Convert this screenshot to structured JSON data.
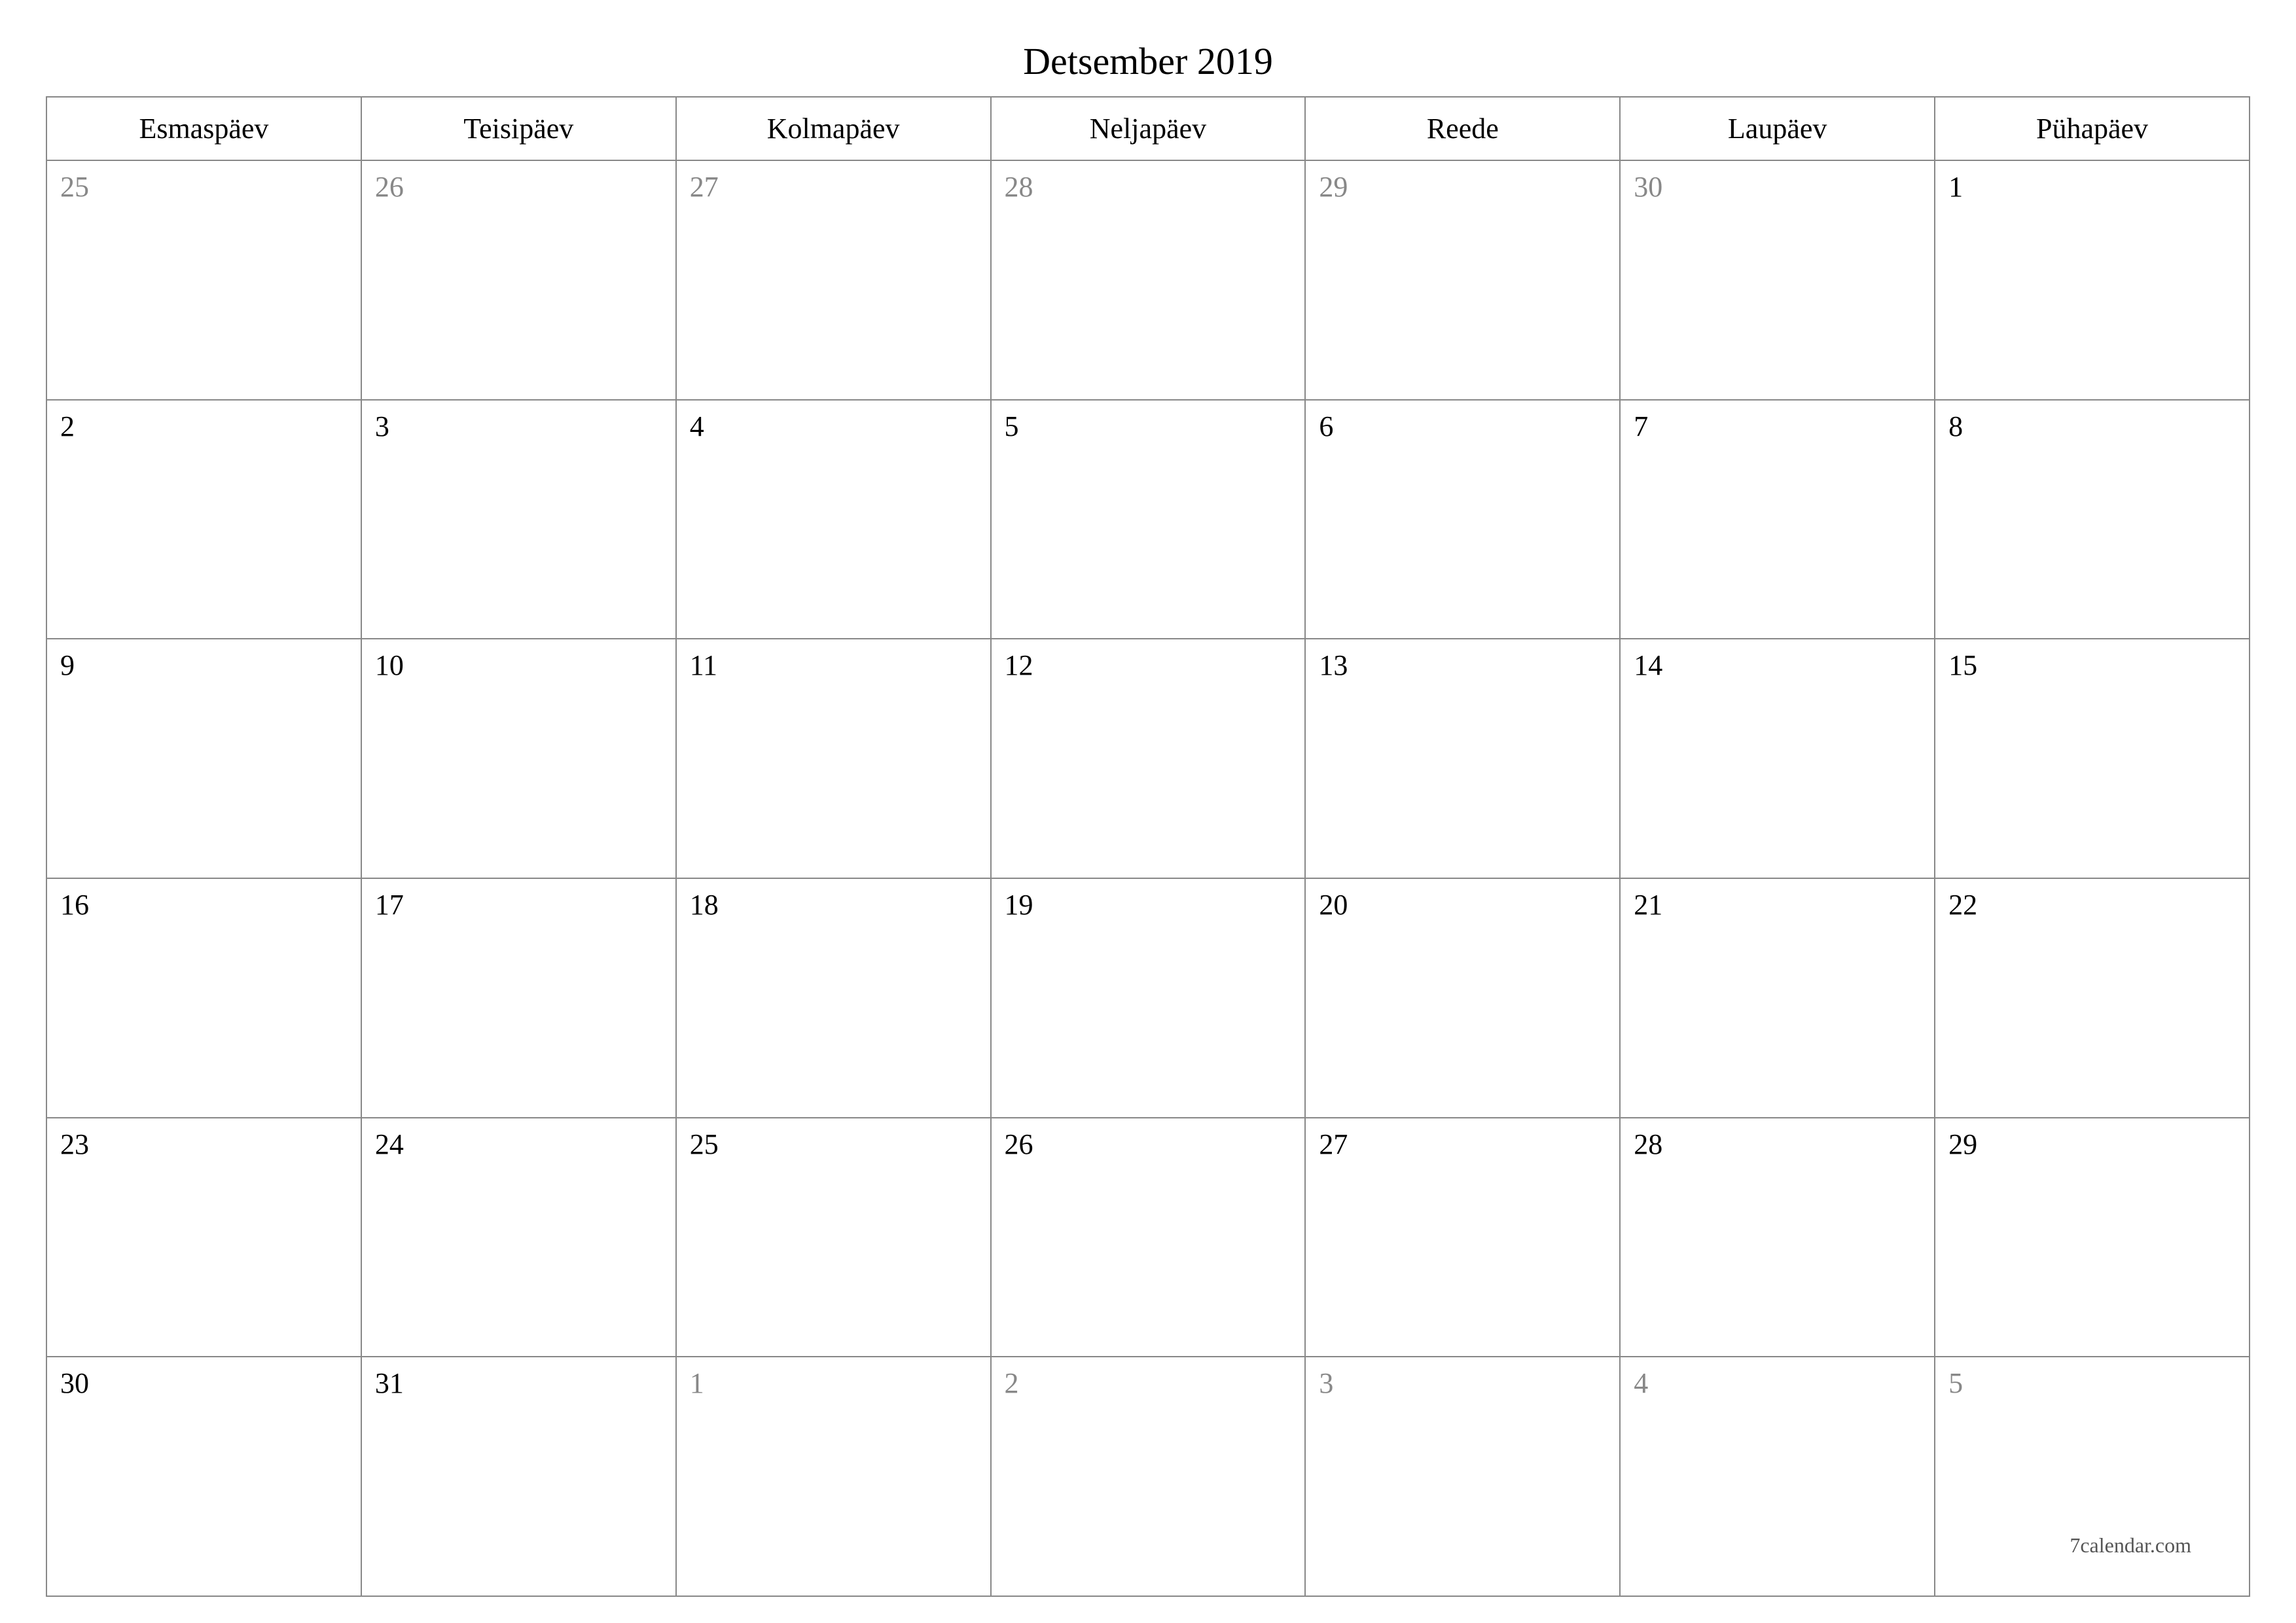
{
  "title": "Detsember 2019",
  "weekdays": [
    "Esmaspäev",
    "Teisipäev",
    "Kolmapäev",
    "Neljapäev",
    "Reede",
    "Laupäev",
    "Pühapäev"
  ],
  "weeks": [
    [
      {
        "day": "25",
        "other": true
      },
      {
        "day": "26",
        "other": true
      },
      {
        "day": "27",
        "other": true
      },
      {
        "day": "28",
        "other": true
      },
      {
        "day": "29",
        "other": true
      },
      {
        "day": "30",
        "other": true
      },
      {
        "day": "1",
        "other": false
      }
    ],
    [
      {
        "day": "2",
        "other": false
      },
      {
        "day": "3",
        "other": false
      },
      {
        "day": "4",
        "other": false
      },
      {
        "day": "5",
        "other": false
      },
      {
        "day": "6",
        "other": false
      },
      {
        "day": "7",
        "other": false
      },
      {
        "day": "8",
        "other": false
      }
    ],
    [
      {
        "day": "9",
        "other": false
      },
      {
        "day": "10",
        "other": false
      },
      {
        "day": "11",
        "other": false
      },
      {
        "day": "12",
        "other": false
      },
      {
        "day": "13",
        "other": false
      },
      {
        "day": "14",
        "other": false
      },
      {
        "day": "15",
        "other": false
      }
    ],
    [
      {
        "day": "16",
        "other": false
      },
      {
        "day": "17",
        "other": false
      },
      {
        "day": "18",
        "other": false
      },
      {
        "day": "19",
        "other": false
      },
      {
        "day": "20",
        "other": false
      },
      {
        "day": "21",
        "other": false
      },
      {
        "day": "22",
        "other": false
      }
    ],
    [
      {
        "day": "23",
        "other": false
      },
      {
        "day": "24",
        "other": false
      },
      {
        "day": "25",
        "other": false
      },
      {
        "day": "26",
        "other": false
      },
      {
        "day": "27",
        "other": false
      },
      {
        "day": "28",
        "other": false
      },
      {
        "day": "29",
        "other": false
      }
    ],
    [
      {
        "day": "30",
        "other": false
      },
      {
        "day": "31",
        "other": false
      },
      {
        "day": "1",
        "other": true
      },
      {
        "day": "2",
        "other": true
      },
      {
        "day": "3",
        "other": true
      },
      {
        "day": "4",
        "other": true
      },
      {
        "day": "5",
        "other": true
      }
    ]
  ],
  "footer": "7calendar.com"
}
